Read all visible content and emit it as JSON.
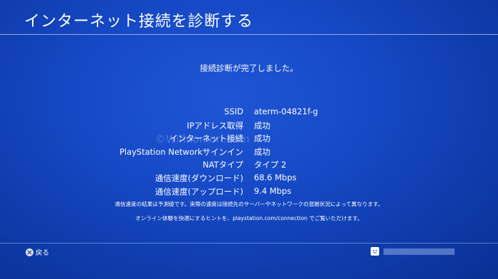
{
  "header": {
    "title": "インターネット接続を診断する"
  },
  "status_message": "接続診断が完了しました。",
  "results": [
    {
      "label": "SSID",
      "value": "aterm-04821f-g"
    },
    {
      "label": "IPアドレス取得",
      "value": "成功"
    },
    {
      "label": "インターネット接続",
      "value": "成功"
    },
    {
      "label": "PlayStation Networkサインイン",
      "value": "成功"
    },
    {
      "label": "NATタイプ",
      "value": "タイプ 2"
    },
    {
      "label": "通信速度(ダウンロード)",
      "value": "68.6 Mbps"
    },
    {
      "label": "通信速度(アップロード)",
      "value": "9.4 Mbps"
    }
  ],
  "notes": {
    "speed_disclaimer": "通信速度の結果は予測値です。実際の速度は接続先のサーバーやネットワークの混雑状況によって異なります。",
    "online_hint": "オンライン体験を快適にするヒントを、playstation.com/connection でご覧いただけます。"
  },
  "watermark": "©Wifinomori.com",
  "footer": {
    "back_label": "戻る",
    "back_icon": "cross-button-icon",
    "user_icon": "user-avatar-icon"
  },
  "colors": {
    "background": "#1548c4",
    "text": "#ffffff"
  }
}
